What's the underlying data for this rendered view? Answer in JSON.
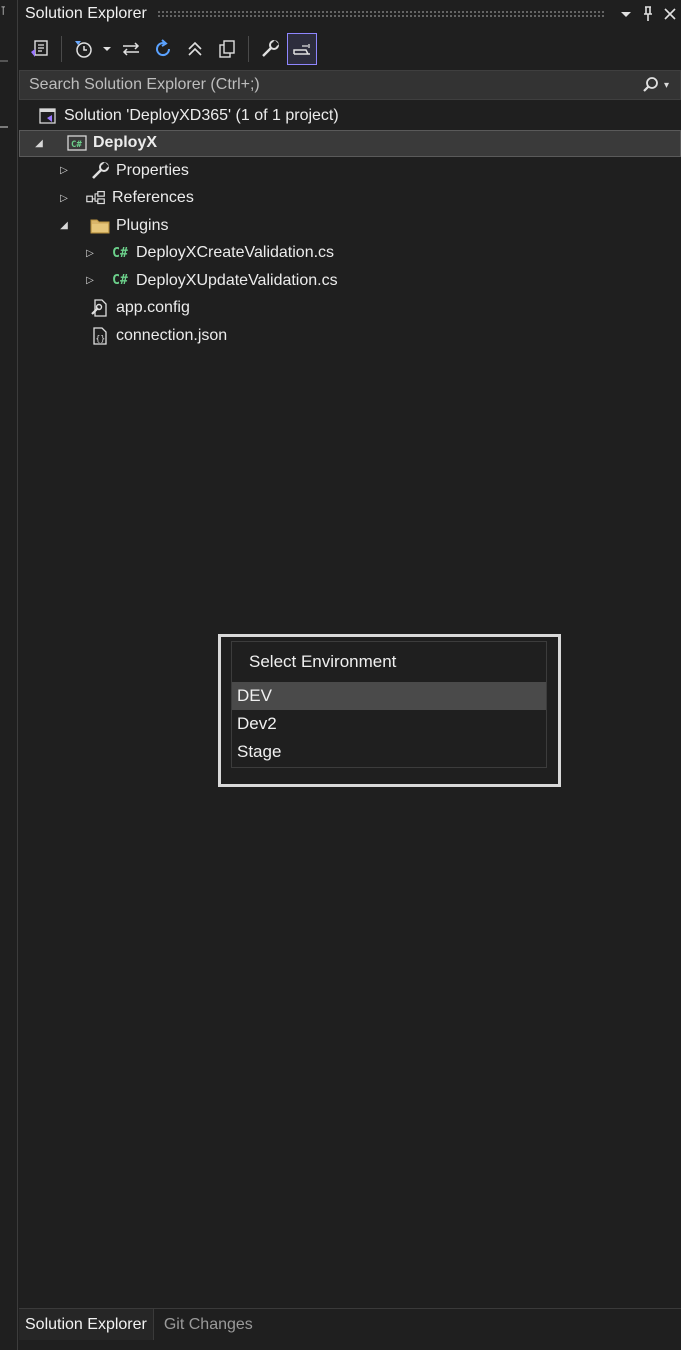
{
  "window": {
    "title": "Solution Explorer",
    "dropdown_icon": "chevron-down-icon",
    "pin_icon": "pin-icon",
    "close_icon": "close-icon"
  },
  "toolbar": {
    "tools": [
      "switch-views-icon",
      "pending-changes-filter-icon",
      "dropdown-icon",
      "sync-active-document-icon",
      "refresh-icon",
      "collapse-all-icon",
      "show-all-files-icon",
      "properties-icon",
      "preview-selected-items-icon"
    ]
  },
  "search": {
    "placeholder": "Search Solution Explorer (Ctrl+;)",
    "value": ""
  },
  "tree": {
    "solution_label": "Solution 'DeployXD365' (1 of 1 project)",
    "project_label": "DeployX",
    "properties_label": "Properties",
    "references_label": "References",
    "plugins_label": "Plugins",
    "file1_label": "DeployXCreateValidation.cs",
    "file2_label": "DeployXUpdateValidation.cs",
    "appconfig_label": "app.config",
    "connection_label": "connection.json",
    "cs_badge": "C#"
  },
  "popup": {
    "title": "Select Environment",
    "options": [
      "DEV",
      "Dev2",
      "Stage"
    ],
    "selected": "DEV"
  },
  "bottom_tabs": {
    "active": "Solution Explorer",
    "inactive": "Git Changes"
  },
  "colors": {
    "background": "#1f1f1f",
    "accent": "#8f86ff",
    "csharp_green": "#6cd18b",
    "selected_row": "#3a3a3a"
  }
}
